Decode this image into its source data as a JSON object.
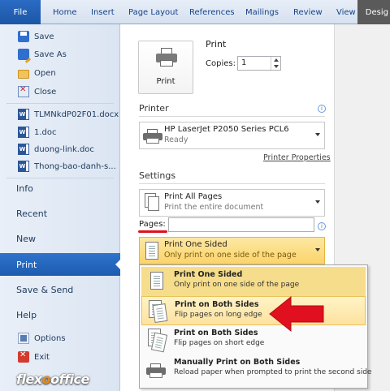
{
  "ribbon": {
    "tabs": [
      "File",
      "Home",
      "Insert",
      "Page Layout",
      "References",
      "Mailings",
      "Review",
      "View",
      "Desig"
    ]
  },
  "nav": {
    "save": "Save",
    "save_as": "Save As",
    "open": "Open",
    "close": "Close",
    "recent_docs": [
      "TLMNkdP02F01.docx",
      "1.doc",
      "duong-link.doc",
      "Thong-bao-danh-s..."
    ],
    "info": "Info",
    "recent": "Recent",
    "new": "New",
    "print": "Print",
    "save_send": "Save & Send",
    "help": "Help",
    "options": "Options",
    "exit": "Exit"
  },
  "logo": {
    "part1": "flex",
    "dot": "o",
    "part2": "office"
  },
  "print_pane": {
    "button_label": "Print",
    "heading": "Print",
    "copies_label": "Copies:",
    "copies_value": "1",
    "printer_heading": "Printer",
    "printer_name": "HP LaserJet P2050 Series PCL6",
    "printer_status": "Ready",
    "printer_properties": "Printer Properties",
    "settings_heading": "Settings",
    "range_title": "Print All Pages",
    "range_sub": "Print the entire document",
    "pages_label": "Pages:",
    "pages_value": "",
    "sided_title": "Print One Sided",
    "sided_sub": "Only print on one side of the page"
  },
  "sided_menu": [
    {
      "title": "Print One Sided",
      "sub": "Only print on one side of the page"
    },
    {
      "title": "Print on Both Sides",
      "sub": "Flip pages on long edge"
    },
    {
      "title": "Print on Both Sides",
      "sub": "Flip pages on short edge"
    },
    {
      "title": "Manually Print on Both Sides",
      "sub": "Reload paper when prompted to print the second side"
    }
  ],
  "colors": {
    "file_tab": "#1c57a6",
    "selected_nav": "#2f73cc",
    "highlight": "#fbd46a",
    "annotation_red": "#e0101e"
  },
  "icons": [
    "save-icon",
    "save-as-icon",
    "open-folder-icon",
    "close-icon",
    "word-doc-icon",
    "options-icon",
    "exit-icon",
    "printer-icon",
    "info-icon",
    "pages-icon",
    "one-sided-icon",
    "duplex-long-icon",
    "duplex-short-icon",
    "manual-duplex-icon",
    "red-arrow-icon"
  ]
}
